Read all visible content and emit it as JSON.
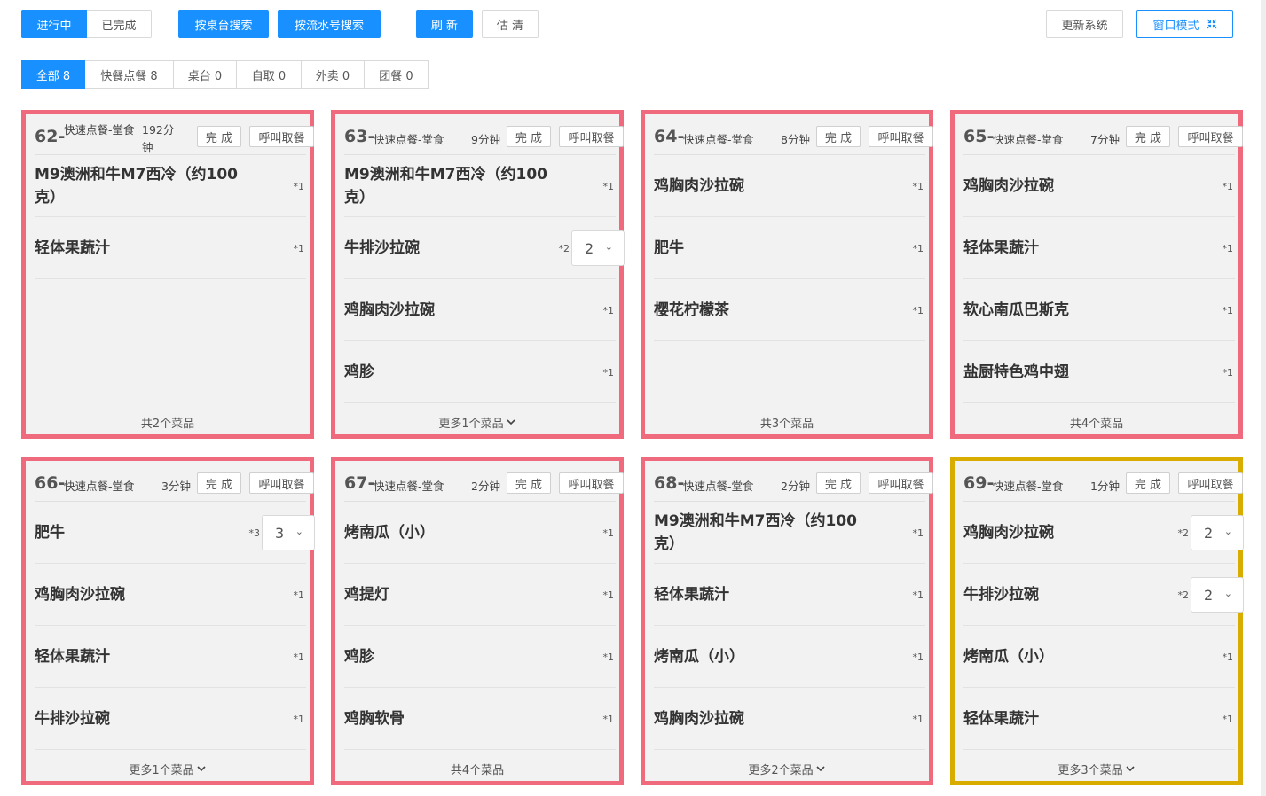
{
  "toolbar": {
    "status_tabs": [
      "进行中",
      "已完成"
    ],
    "search_by_table": "按桌台搜索",
    "search_by_serial": "按流水号搜索",
    "refresh": "刷 新",
    "clear": "估 清",
    "update_system": "更新系统",
    "window_mode": "窗口模式",
    "window_mode_icon": "compress-icon"
  },
  "category_tabs": [
    {
      "label": "全部 8",
      "active": true
    },
    {
      "label": "快餐点餐 8",
      "active": false
    },
    {
      "label": "桌台 0",
      "active": false
    },
    {
      "label": "自取 0",
      "active": false
    },
    {
      "label": "外卖 0",
      "active": false
    },
    {
      "label": "团餐 0",
      "active": false
    }
  ],
  "cards": [
    {
      "num": "62-",
      "type": "快速点餐-堂食",
      "time": "192分钟",
      "done": "完 成",
      "call": "呼叫取餐",
      "border": "#f06a7e",
      "items": [
        {
          "name": "M9澳洲和牛M7西冷（约100克）",
          "qty": "*1"
        },
        {
          "name": "轻体果蔬汁",
          "qty": "*1"
        }
      ],
      "footer": "共2个菜品"
    },
    {
      "num": "63-",
      "type": "快速点餐-堂食",
      "time": "9分钟",
      "done": "完 成",
      "call": "呼叫取餐",
      "border": "#f06a7e",
      "items": [
        {
          "name": "M9澳洲和牛M7西冷（约100克）",
          "qty": "*1"
        },
        {
          "name": "牛排沙拉碗",
          "qty": "*2",
          "select": "2"
        },
        {
          "name": "鸡胸肉沙拉碗",
          "qty": "*1"
        },
        {
          "name": "鸡胗",
          "qty": "*1"
        }
      ],
      "footer": "更多1个菜品"
    },
    {
      "num": "64-",
      "type": "快速点餐-堂食",
      "time": "8分钟",
      "done": "完 成",
      "call": "呼叫取餐",
      "border": "#f06a7e",
      "items": [
        {
          "name": "鸡胸肉沙拉碗",
          "qty": "*1"
        },
        {
          "name": "肥牛",
          "qty": "*1"
        },
        {
          "name": "樱花柠檬茶",
          "qty": "*1"
        }
      ],
      "footer": "共3个菜品"
    },
    {
      "num": "65-",
      "type": "快速点餐-堂食",
      "time": "7分钟",
      "done": "完 成",
      "call": "呼叫取餐",
      "border": "#f06a7e",
      "items": [
        {
          "name": "鸡胸肉沙拉碗",
          "qty": "*1"
        },
        {
          "name": "轻体果蔬汁",
          "qty": "*1"
        },
        {
          "name": "软心南瓜巴斯克",
          "qty": "*1"
        },
        {
          "name": "盐厨特色鸡中翅",
          "qty": "*1"
        }
      ],
      "footer": "共4个菜品"
    },
    {
      "num": "66-",
      "type": "快速点餐-堂食",
      "time": "3分钟",
      "done": "完 成",
      "call": "呼叫取餐",
      "border": "#f06a7e",
      "items": [
        {
          "name": "肥牛",
          "qty": "*3",
          "select": "3"
        },
        {
          "name": "鸡胸肉沙拉碗",
          "qty": "*1"
        },
        {
          "name": "轻体果蔬汁",
          "qty": "*1"
        },
        {
          "name": "牛排沙拉碗",
          "qty": "*1"
        }
      ],
      "footer": "更多1个菜品"
    },
    {
      "num": "67-",
      "type": "快速点餐-堂食",
      "time": "2分钟",
      "done": "完 成",
      "call": "呼叫取餐",
      "border": "#f06a7e",
      "items": [
        {
          "name": "烤南瓜（小）",
          "qty": "*1"
        },
        {
          "name": "鸡提灯",
          "qty": "*1"
        },
        {
          "name": "鸡胗",
          "qty": "*1"
        },
        {
          "name": "鸡胸软骨",
          "qty": "*1"
        }
      ],
      "footer": "共4个菜品"
    },
    {
      "num": "68-",
      "type": "快速点餐-堂食",
      "time": "2分钟",
      "done": "完 成",
      "call": "呼叫取餐",
      "border": "#f06a7e",
      "items": [
        {
          "name": "M9澳洲和牛M7西冷（约100克）",
          "qty": "*1"
        },
        {
          "name": "轻体果蔬汁",
          "qty": "*1"
        },
        {
          "name": "烤南瓜（小）",
          "qty": "*1"
        },
        {
          "name": "鸡胸肉沙拉碗",
          "qty": "*1"
        }
      ],
      "footer": "更多2个菜品"
    },
    {
      "num": "69-",
      "type": "快速点餐-堂食",
      "time": "1分钟",
      "done": "完 成",
      "call": "呼叫取餐",
      "border": "#d9ad00",
      "items": [
        {
          "name": "鸡胸肉沙拉碗",
          "qty": "*2",
          "select": "2"
        },
        {
          "name": "牛排沙拉碗",
          "qty": "*2",
          "select": "2"
        },
        {
          "name": "烤南瓜（小）",
          "qty": "*1"
        },
        {
          "name": "轻体果蔬汁",
          "qty": "*1"
        }
      ],
      "footer": "更多3个菜品"
    }
  ]
}
